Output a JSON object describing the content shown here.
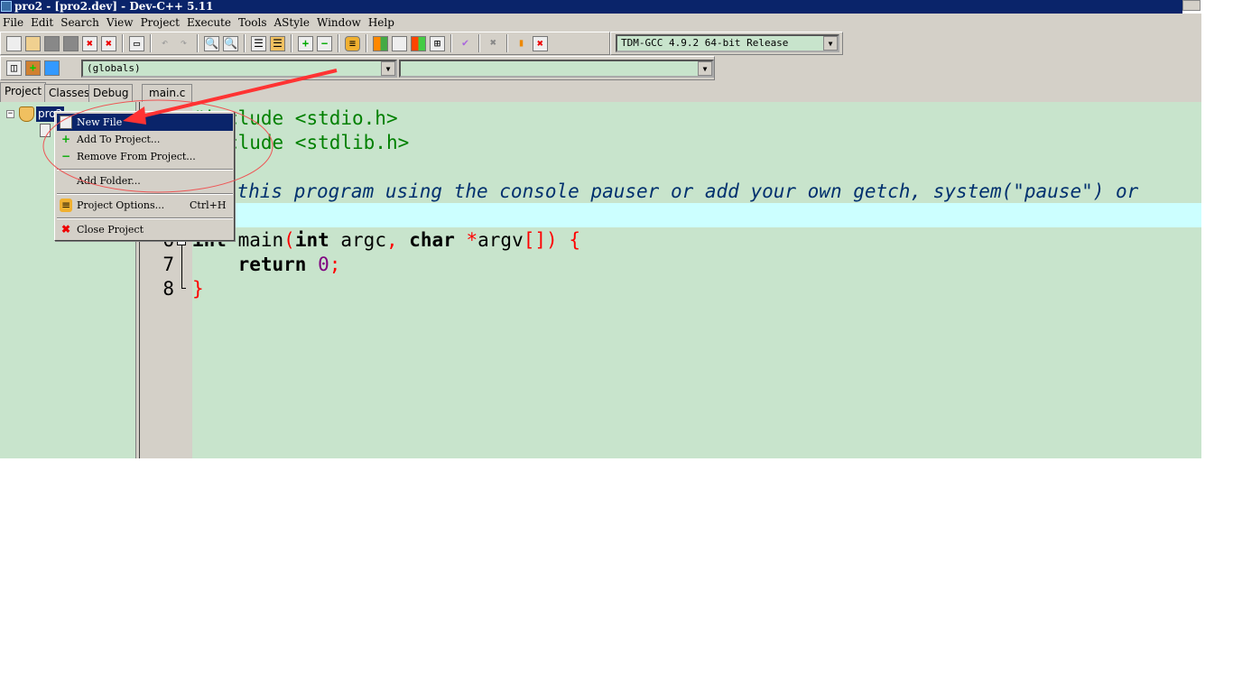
{
  "window": {
    "title": "pro2 - [pro2.dev] - Dev-C++ 5.11"
  },
  "menubar": [
    "File",
    "Edit",
    "Search",
    "View",
    "Project",
    "Execute",
    "Tools",
    "AStyle",
    "Window",
    "Help"
  ],
  "toolbar": {
    "compiler": "TDM-GCC 4.9.2 64-bit Release",
    "scope": "(globals)",
    "function": ""
  },
  "panel_tabs": [
    "Project",
    "Classes",
    "Debug"
  ],
  "editor_tab": "main.c",
  "project_tree": {
    "root": "pro2"
  },
  "code": {
    "line_numbers": [
      "6",
      "7",
      "8"
    ],
    "l1": [
      "#include",
      " <stdio.h>"
    ],
    "l2": [
      "#include",
      " <stdlib.h>"
    ],
    "l4": "/* run this program using the console pauser or add your own getch, system(\"pause\") or",
    "l6": [
      "int",
      " main",
      "(",
      "int",
      " argc",
      ",",
      " char ",
      "*",
      "argv",
      "[]",
      ")",
      " {"
    ],
    "l7": [
      "    return ",
      "0",
      ";"
    ],
    "l8": "}"
  },
  "context_menu": {
    "items": [
      {
        "label": "New File",
        "icon": "new-file-icon"
      },
      {
        "label": "Add To Project...",
        "icon": "add-icon"
      },
      {
        "label": "Remove From Project...",
        "icon": "remove-icon"
      },
      {
        "label": "Add Folder..."
      },
      {
        "label": "Project Options...",
        "shortcut": "Ctrl+H",
        "icon": "options-icon"
      },
      {
        "label": "Close Project",
        "icon": "close-icon"
      }
    ]
  },
  "colors": {
    "editor_bg": "#c8e4cc",
    "highlight_line": "#ccffff",
    "annotation": "#ff3333",
    "selection": "#0a246a"
  }
}
